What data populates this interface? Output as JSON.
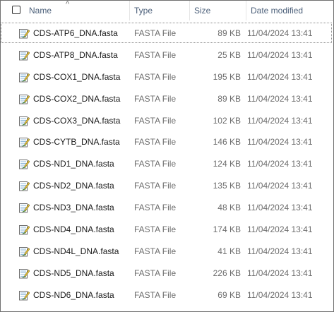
{
  "columns": {
    "name": "Name",
    "type": "Type",
    "size": "Size",
    "date": "Date modified"
  },
  "sort_indicator": "^",
  "files": [
    {
      "name": "CDS-ATP6_DNA.fasta",
      "type": "FASTA File",
      "size": "89 KB",
      "date": "11/04/2024 13:41"
    },
    {
      "name": "CDS-ATP8_DNA.fasta",
      "type": "FASTA File",
      "size": "25 KB",
      "date": "11/04/2024 13:41"
    },
    {
      "name": "CDS-COX1_DNA.fasta",
      "type": "FASTA File",
      "size": "195 KB",
      "date": "11/04/2024 13:41"
    },
    {
      "name": "CDS-COX2_DNA.fasta",
      "type": "FASTA File",
      "size": "89 KB",
      "date": "11/04/2024 13:41"
    },
    {
      "name": "CDS-COX3_DNA.fasta",
      "type": "FASTA File",
      "size": "102 KB",
      "date": "11/04/2024 13:41"
    },
    {
      "name": "CDS-CYTB_DNA.fasta",
      "type": "FASTA File",
      "size": "146 KB",
      "date": "11/04/2024 13:41"
    },
    {
      "name": "CDS-ND1_DNA.fasta",
      "type": "FASTA File",
      "size": "124 KB",
      "date": "11/04/2024 13:41"
    },
    {
      "name": "CDS-ND2_DNA.fasta",
      "type": "FASTA File",
      "size": "135 KB",
      "date": "11/04/2024 13:41"
    },
    {
      "name": "CDS-ND3_DNA.fasta",
      "type": "FASTA File",
      "size": "48 KB",
      "date": "11/04/2024 13:41"
    },
    {
      "name": "CDS-ND4_DNA.fasta",
      "type": "FASTA File",
      "size": "174 KB",
      "date": "11/04/2024 13:41"
    },
    {
      "name": "CDS-ND4L_DNA.fasta",
      "type": "FASTA File",
      "size": "41 KB",
      "date": "11/04/2024 13:41"
    },
    {
      "name": "CDS-ND5_DNA.fasta",
      "type": "FASTA File",
      "size": "226 KB",
      "date": "11/04/2024 13:41"
    },
    {
      "name": "CDS-ND6_DNA.fasta",
      "type": "FASTA File",
      "size": "69 KB",
      "date": "11/04/2024 13:41"
    }
  ],
  "file_icon": "fasta-file-icon",
  "colors": {
    "header_text": "#4c607a",
    "secondary_text": "#6d6d6d",
    "border": "#707070"
  }
}
